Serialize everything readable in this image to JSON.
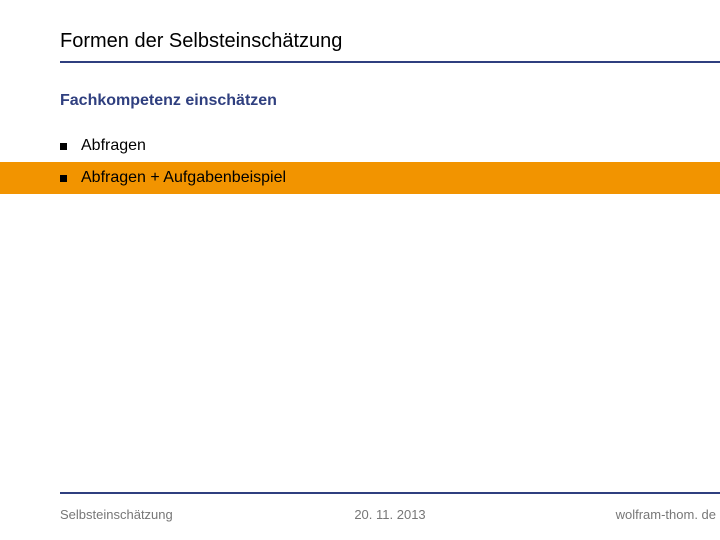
{
  "header": {
    "title": "Formen der Selbsteinschätzung"
  },
  "subtitle": "Fachkompetenz einschätzen",
  "bullets": [
    {
      "text": "Abfragen",
      "highlight": false
    },
    {
      "text": "Abfragen + Aufgabenbeispiel",
      "highlight": true
    }
  ],
  "footer": {
    "left": "Selbsteinschätzung",
    "center": "20. 11. 2013",
    "right": "wolfram-thom. de"
  }
}
